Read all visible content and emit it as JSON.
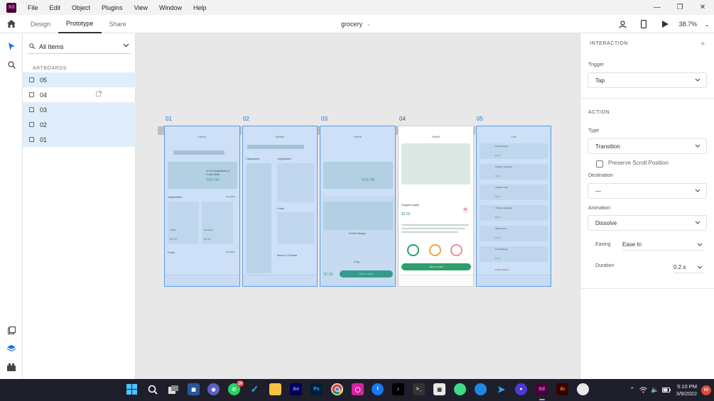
{
  "app": {
    "logo_text": "Xd",
    "document_name": "grocery",
    "zoom": "38.7%"
  },
  "menu": [
    "File",
    "Edit",
    "Object",
    "Plugins",
    "View",
    "Window",
    "Help"
  ],
  "mode_tabs": [
    "Design",
    "Prototype",
    "Share"
  ],
  "active_mode": "Prototype",
  "layers": {
    "filter_label": "All Items",
    "heading": "ARTBOARDS",
    "items": [
      {
        "label": "05",
        "selected": true
      },
      {
        "label": "04",
        "selected": false
      },
      {
        "label": "03",
        "selected": true
      },
      {
        "label": "02",
        "selected": true
      },
      {
        "label": "01",
        "selected": true
      }
    ]
  },
  "artboards": [
    {
      "label": "01",
      "title": "Home",
      "selected": true
    },
    {
      "label": "02",
      "title": "Search",
      "selected": true
    },
    {
      "label": "03",
      "title": "Home",
      "selected": true
    },
    {
      "label": "04",
      "title": "Detail",
      "selected": false
    },
    {
      "label": "05",
      "title": "Cart",
      "selected": true
    }
  ],
  "artboard_text": {
    "home_promo": "In All Vegetables & Fruits Mart",
    "home_discount": "%15 Off",
    "vegetables": "Vegetables",
    "see_more": "See More",
    "fruits": "Fruits",
    "ginger": "Ginger",
    "ginger_price": "$8.30",
    "tomatoes": "Tomatoes",
    "tomatoes_price": "$2.64",
    "categories": "Categories",
    "meat_chicken": "Meat & Chicken",
    "fresh_mango": "Fresh Mango",
    "weight": "3 kg",
    "mango_price": "$7.05",
    "add_to_cart": "ADD TO CART",
    "organic_apple": "Organic Apple",
    "apple_price": "$3.65",
    "cart_item_1": "Fresh Parsley",
    "cart_price_1": "$0.08",
    "cart_item_2": "Organic Tomatoes",
    "cart_price_2": "$3.64",
    "cart_item_3": "Chicken Legs",
    "cart_price_3": "$9.00",
    "cart_item_4": "Chinese Cabbage",
    "cart_price_4": "$8.60",
    "cart_item_5": "Watermelon",
    "cart_price_5": "$4.00",
    "cart_item_6": "Fresh Mango",
    "cart_price_6": "$0.08",
    "cart_item_7": "Fresh Chicken"
  },
  "inspector": {
    "interaction_heading": "INTERACTION",
    "trigger_label": "Trigger",
    "trigger_value": "Tap",
    "action_heading": "ACTION",
    "type_label": "Type",
    "type_value": "Transition",
    "preserve_scroll": "Preserve Scroll Position",
    "destination_label": "Destination",
    "destination_value": "—",
    "animation_label": "Animation",
    "animation_value": "Dissolve",
    "easing_label": "Easing",
    "easing_value": "Ease In",
    "duration_label": "Duration",
    "duration_value": "0.2 s"
  },
  "taskbar": {
    "whatsapp_badge": "10",
    "time": "5:10 PM",
    "date": "3/9/2022",
    "notifications": "69"
  },
  "colors": {
    "accent": "#1473e6",
    "selection": "#dfeefa",
    "xd_purple": "#470137",
    "green": "#2e9e6b"
  }
}
